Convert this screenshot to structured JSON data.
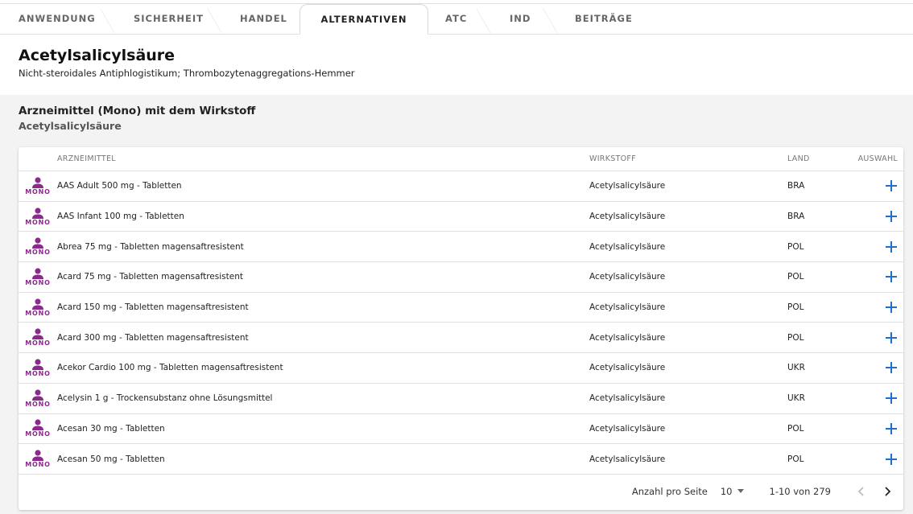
{
  "tabs": [
    {
      "label": "ANWENDUNG"
    },
    {
      "label": "SICHERHEIT"
    },
    {
      "label": "HANDEL"
    },
    {
      "label": "ALTERNATIVEN"
    },
    {
      "label": "ATC"
    },
    {
      "label": "IND"
    },
    {
      "label": "BEITRÄGE"
    }
  ],
  "active_tab": "ALTERNATIVEN",
  "substance": {
    "title": "Acetylsalicylsäure",
    "subtitle": "Nicht-steroidales Antiphlogistikum; Thrombozytenaggregations-Hemmer"
  },
  "section": {
    "title": "Arzneimittel (Mono) mit dem Wirkstoff",
    "subtitle": "Acetylsalicylsäure"
  },
  "table": {
    "columns": [
      "ARZNEIMITTEL",
      "WIRKSTOFF",
      "LAND",
      "AUSWAHL"
    ],
    "badge_label": "MONO",
    "rows": [
      {
        "name": "AAS Adult 500 mg - Tabletten",
        "wirkstoff": "Acetylsalicylsäure",
        "land": "BRA"
      },
      {
        "name": "AAS Infant 100 mg - Tabletten",
        "wirkstoff": "Acetylsalicylsäure",
        "land": "BRA"
      },
      {
        "name": "Abrea 75 mg - Tabletten magensaftresistent",
        "wirkstoff": "Acetylsalicylsäure",
        "land": "POL"
      },
      {
        "name": "Acard 75 mg - Tabletten magensaftresistent",
        "wirkstoff": "Acetylsalicylsäure",
        "land": "POL"
      },
      {
        "name": "Acard 150 mg - Tabletten magensaftresistent",
        "wirkstoff": "Acetylsalicylsäure",
        "land": "POL"
      },
      {
        "name": "Acard 300 mg - Tabletten magensaftresistent",
        "wirkstoff": "Acetylsalicylsäure",
        "land": "POL"
      },
      {
        "name": "Acekor Cardio 100 mg - Tabletten magensaftresistent",
        "wirkstoff": "Acetylsalicylsäure",
        "land": "UKR"
      },
      {
        "name": "Acelysin 1 g - Trockensubstanz ohne Lösungsmittel",
        "wirkstoff": "Acetylsalicylsäure",
        "land": "UKR"
      },
      {
        "name": "Acesan 30 mg - Tabletten",
        "wirkstoff": "Acetylsalicylsäure",
        "land": "POL"
      },
      {
        "name": "Acesan 50 mg - Tabletten",
        "wirkstoff": "Acetylsalicylsäure",
        "land": "POL"
      }
    ]
  },
  "pagination": {
    "per_page_label": "Anzahl pro Seite",
    "per_page_value": "10",
    "range": "1-10 von 279"
  },
  "colors": {
    "accent_purple": "#8a2a8c",
    "action_blue": "#1f6fd1"
  },
  "icons": {
    "row_icon": "person-icon",
    "add": "plus-icon",
    "prev": "chevron-left-icon",
    "next": "chevron-right-icon",
    "dropdown": "caret-down-icon"
  }
}
